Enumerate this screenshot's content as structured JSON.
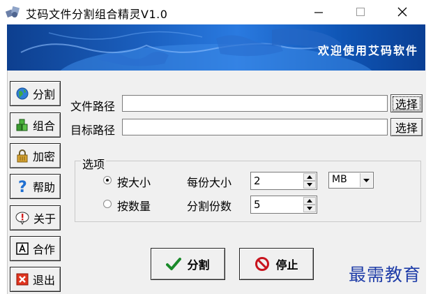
{
  "window": {
    "title": "艾码文件分割组合精灵V1.0",
    "controls": {
      "minimize": "—",
      "maximize": "☐",
      "close": "✕"
    }
  },
  "banner": {
    "welcome": "欢迎使用艾码软件"
  },
  "sidebar": {
    "items": [
      {
        "label": "分割",
        "icon": "globe-icon"
      },
      {
        "label": "组合",
        "icon": "blocks-icon"
      },
      {
        "label": "加密",
        "icon": "lock-icon"
      },
      {
        "label": "帮助",
        "icon": "question-icon"
      },
      {
        "label": "关于",
        "icon": "info-icon"
      },
      {
        "label": "合作",
        "icon": "partner-icon"
      },
      {
        "label": "退出",
        "icon": "exit-icon"
      }
    ]
  },
  "form": {
    "file_path_label": "文件路径",
    "file_path_value": "",
    "target_path_label": "目标路径",
    "target_path_value": "",
    "browse_label": "选择"
  },
  "options": {
    "legend": "选项",
    "by_size_label": "按大小",
    "by_count_label": "按数量",
    "selected_mode": "按大小",
    "size_per_part_label": "每份大小",
    "size_per_part_value": "2",
    "unit_value": "MB",
    "part_count_label": "分割份数",
    "part_count_value": "5"
  },
  "actions": {
    "split_label": "分割",
    "stop_label": "停止"
  },
  "watermark": "最需教育",
  "colors": {
    "banner_blue": "#1c62c2",
    "check_green": "#1a8a2a",
    "stop_red": "#c8141e",
    "watermark_blue": "#1f3da8"
  }
}
